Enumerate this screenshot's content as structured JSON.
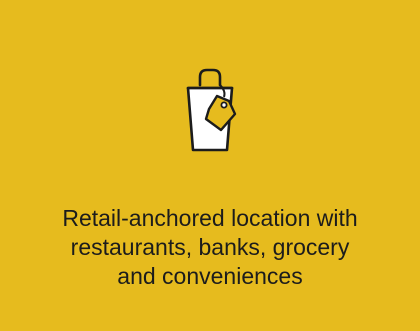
{
  "card": {
    "background": "#E6BB1E",
    "icon": "shopping-bag-with-tag-icon",
    "caption_lines": [
      "Retail-anchored location with",
      "restaurants, banks, grocery",
      "and conveniences"
    ]
  }
}
